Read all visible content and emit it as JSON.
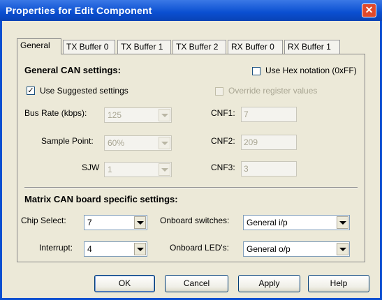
{
  "window": {
    "title": "Properties for Edit Component",
    "close_icon": "close-icon"
  },
  "tabs": [
    "General",
    "TX Buffer 0",
    "TX Buffer 1",
    "TX Buffer 2",
    "RX Buffer 0",
    "RX Buffer 1"
  ],
  "general_section": {
    "title": "General CAN settings:",
    "use_hex": {
      "label": "Use Hex notation (0xFF)",
      "checked": false
    },
    "use_suggested": {
      "label": "Use Suggested settings",
      "checked": true
    },
    "override": {
      "label": "Override register values",
      "checked": false
    },
    "bus_rate": {
      "label": "Bus Rate (kbps):",
      "value": "125"
    },
    "sample_point": {
      "label": "Sample Point:",
      "value": "60%"
    },
    "sjw": {
      "label": "SJW",
      "value": "1"
    },
    "cnf1": {
      "label": "CNF1:",
      "value": "7"
    },
    "cnf2": {
      "label": "CNF2:",
      "value": "209"
    },
    "cnf3": {
      "label": "CNF3:",
      "value": "3"
    }
  },
  "matrix_section": {
    "title": "Matrix CAN board specific settings:",
    "chip_select": {
      "label": "Chip Select:",
      "value": "7"
    },
    "interrupt": {
      "label": "Interrupt:",
      "value": "4"
    },
    "onboard_switches": {
      "label": "Onboard switches:",
      "value": "General i/p"
    },
    "onboard_leds": {
      "label": "Onboard LED's:",
      "value": "General o/p"
    }
  },
  "buttons": {
    "ok": "OK",
    "cancel": "Cancel",
    "apply": "Apply",
    "help": "Help"
  },
  "colors": {
    "titlebar": "#0a4fd1",
    "dialog_bg": "#ece9d8",
    "close": "#e0492b"
  }
}
